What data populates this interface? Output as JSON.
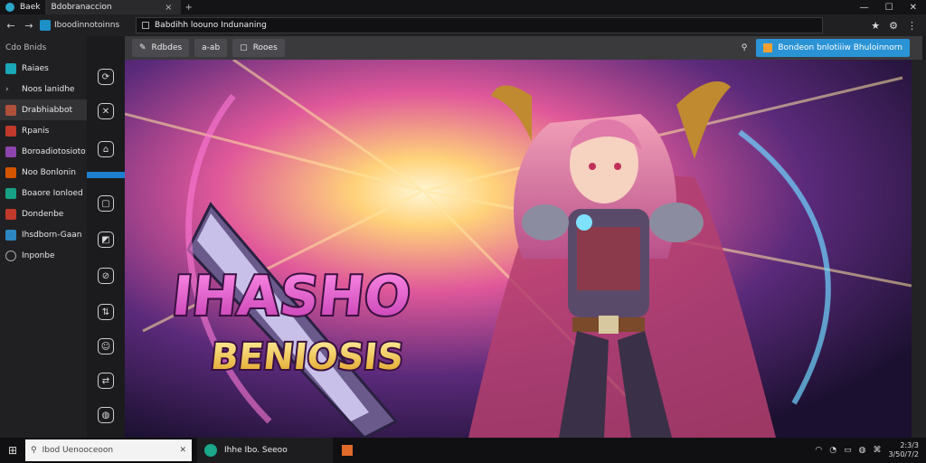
{
  "browser": {
    "tabs": [
      {
        "label": "Baek",
        "active": false
      },
      {
        "label": "Bdobranaccion",
        "active": true
      }
    ],
    "tab_close": "×",
    "new_tab": "+",
    "window": {
      "minimize": "—",
      "maximize": "☐",
      "close": "✕"
    },
    "address": {
      "back": "←",
      "forward": "→",
      "page_title": "Iboodinnotoinns",
      "url": "Babdihh loouno Indunaning",
      "star": "★",
      "menu": "⚙",
      "more": "⋮"
    }
  },
  "sidebar": {
    "heading": "Cdo Bnids",
    "items": [
      {
        "label": "Raiaes",
        "color": "#1aa7b8"
      },
      {
        "label": "Noos lanidhe",
        "color": "#666666"
      },
      {
        "label": "Drabhiabbot",
        "color": "#b0503a",
        "active": true
      },
      {
        "label": "Rpanis",
        "color": "#c0392b"
      },
      {
        "label": "Boroadiotosioto",
        "color": "#8e44ad"
      },
      {
        "label": "Noo Bonlonin",
        "color": "#d35400"
      },
      {
        "label": "Boaore Ionloed",
        "color": "#16a085"
      },
      {
        "label": "Dondenbe",
        "color": "#c0392b"
      },
      {
        "label": "Ihsdborn-Gaan",
        "color": "#2e86c1"
      },
      {
        "label": "Inponbe",
        "color": "#777777"
      }
    ]
  },
  "rail": {
    "buttons": [
      "⟳",
      "✕",
      "⌂",
      "▢",
      "◩",
      "⊘",
      "⇅",
      "☺",
      "⇄",
      "◍"
    ]
  },
  "toolbar": {
    "tool1": "Rdbdes",
    "tool2": "a-ab",
    "tool3": "Rooes",
    "notice": "Bondeon bnlotiiiw Bhuloinnorn"
  },
  "artwork": {
    "title_line1": "IHASHO",
    "title_line2": "BENIOSIS"
  },
  "taskbar": {
    "start": "⊞",
    "search_placeholder": "Ibod Uenooceoon",
    "app_label": "Ihhe Ibo. Seeoo",
    "time": "2:3/3",
    "date": "3/50/7/2"
  },
  "colors": {
    "accent": "#1d7fd0",
    "notice": "#2a93d6",
    "title_pink": "#e255c8",
    "title_gold": "#f5c542"
  }
}
